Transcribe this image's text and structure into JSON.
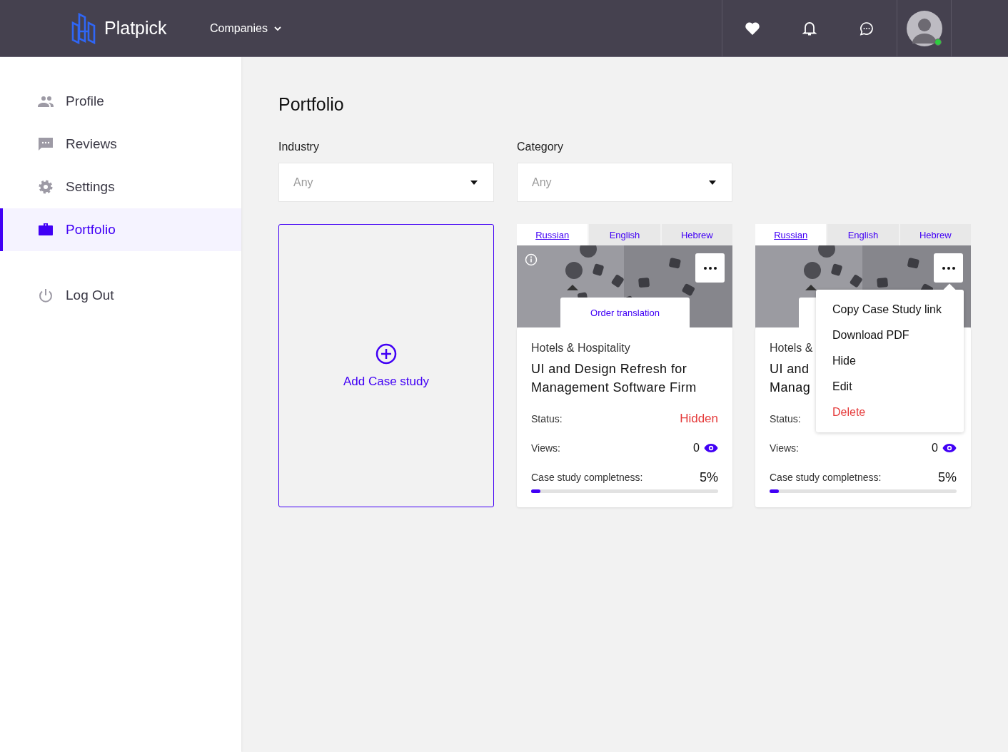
{
  "header": {
    "brand": "Platpick",
    "nav": [
      {
        "label": "Companies"
      }
    ],
    "user": {
      "online": true
    }
  },
  "sidebar": {
    "items": [
      {
        "label": "Profile",
        "selected": false
      },
      {
        "label": "Reviews",
        "selected": false
      },
      {
        "label": "Settings",
        "selected": false
      },
      {
        "label": "Portfolio",
        "selected": true
      }
    ],
    "logout": {
      "label": "Log Out"
    }
  },
  "page": {
    "title": "Portfolio",
    "filters": [
      {
        "label": "Industry",
        "value": "Any"
      },
      {
        "label": "Category",
        "value": "Any"
      }
    ],
    "add_card": {
      "label": "Add Case study"
    },
    "cards": [
      {
        "tabs": [
          {
            "label": "Russian",
            "selected": true
          },
          {
            "label": "English",
            "selected": false
          },
          {
            "label": "Hebrew",
            "selected": false
          }
        ],
        "info": true,
        "order_translation": "Order translation",
        "category": "Hotels & Hospitality",
        "title_lines": [
          "UI and Design Refresh for",
          "Management Software Firm"
        ],
        "status_label": "Status:",
        "status_value": "Hidden",
        "views_label": "Views:",
        "views": "0",
        "completeness_label": "Case study completness:",
        "completeness": "5%",
        "level": 0.05
      },
      {
        "tabs": [
          {
            "label": "Russian",
            "selected": true
          },
          {
            "label": "English",
            "selected": false
          },
          {
            "label": "Hebrew",
            "selected": false
          }
        ],
        "info": false,
        "category": "Hotels &",
        "title_lines": [
          "UI and",
          "Manag"
        ],
        "status_label": "Status:",
        "views_label": "Views:",
        "views": "0",
        "completeness_label": "Case study completness:",
        "completeness": "5%",
        "level": 0.05,
        "menu": [
          {
            "label": "Copy Case Study link",
            "kind": "normal"
          },
          {
            "label": "Download PDF",
            "kind": "normal"
          },
          {
            "label": "Hide",
            "kind": "normal"
          },
          {
            "label": "Edit",
            "kind": "normal"
          },
          {
            "label": "Delete",
            "kind": "danger"
          }
        ]
      }
    ]
  }
}
